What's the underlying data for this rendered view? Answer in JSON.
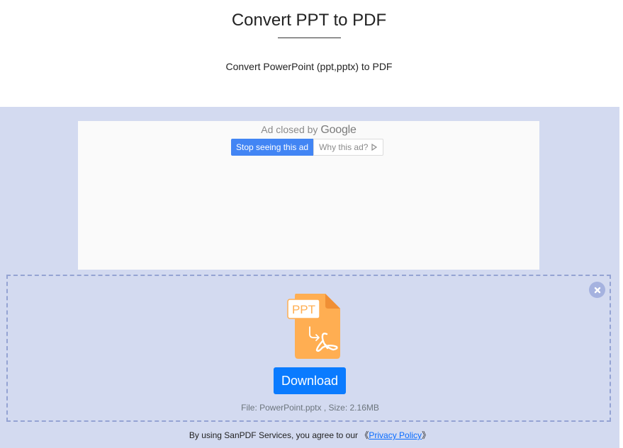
{
  "header": {
    "title": "Convert PPT to PDF",
    "subtitle": "Convert PowerPoint (ppt,pptx) to PDF"
  },
  "ad": {
    "closed_text": "Ad closed by",
    "brand": "Google",
    "stop_button": "Stop seeing this ad",
    "why_button": "Why this ad?"
  },
  "result": {
    "file_badge": "PPT",
    "download_label": "Download",
    "file_info": "File: PowerPoint.pptx , Size: 2.16MB"
  },
  "footer": {
    "text_before": "By using SanPDF Services, you agree to our ",
    "bracket_open": "《",
    "privacy_link": "Privacy Policy",
    "bracket_close": "》"
  },
  "colors": {
    "content_bg": "#d3daf0",
    "accent": "#0a7bff",
    "file_icon": "#ffae52",
    "ad_button": "#4285f4"
  },
  "icons": [
    "close-icon",
    "ppt-to-pdf-file-icon",
    "adchoices-icon"
  ]
}
